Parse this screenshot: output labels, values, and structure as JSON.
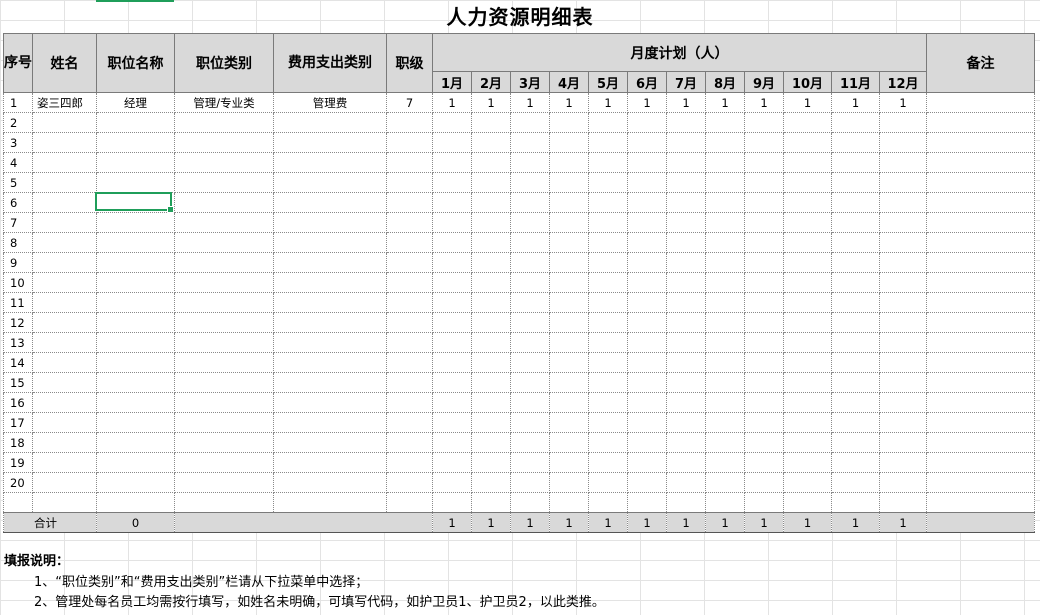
{
  "title": "人力资源明细表",
  "header": {
    "seq": "序号",
    "name": "姓名",
    "position_name": "职位名称",
    "position_type": "职位类别",
    "expense_type": "费用支出类别",
    "level": "职级",
    "monthly_plan": "月度计划（人）",
    "remark": "备注",
    "months": [
      "1月",
      "2月",
      "3月",
      "4月",
      "5月",
      "6月",
      "7月",
      "8月",
      "9月",
      "10月",
      "11月",
      "12月"
    ]
  },
  "rows": [
    {
      "seq": "1",
      "name": "姿三四郎",
      "position_name": "经理",
      "position_type": "管理/专业类",
      "expense_type": "管理费",
      "level": "7",
      "months": [
        "1",
        "1",
        "1",
        "1",
        "1",
        "1",
        "1",
        "1",
        "1",
        "1",
        "1",
        "1"
      ],
      "remark": ""
    },
    {
      "seq": "2"
    },
    {
      "seq": "3"
    },
    {
      "seq": "4"
    },
    {
      "seq": "5"
    },
    {
      "seq": "6"
    },
    {
      "seq": "7"
    },
    {
      "seq": "8"
    },
    {
      "seq": "9"
    },
    {
      "seq": "10"
    },
    {
      "seq": "11"
    },
    {
      "seq": "12"
    },
    {
      "seq": "13"
    },
    {
      "seq": "14"
    },
    {
      "seq": "15"
    },
    {
      "seq": "16"
    },
    {
      "seq": "17"
    },
    {
      "seq": "18"
    },
    {
      "seq": "19"
    },
    {
      "seq": "20"
    },
    {
      "seq": ""
    }
  ],
  "total": {
    "label": "合计",
    "position_count": "0",
    "months": [
      "1",
      "1",
      "1",
      "1",
      "1",
      "1",
      "1",
      "1",
      "1",
      "1",
      "1",
      "1"
    ]
  },
  "notes": {
    "title": "填报说明：",
    "lines": [
      "1、“职位类别”和“费用支出类别”栏请从下拉菜单中选择；",
      "2、管理处每名员工均需按行填写，如姓名未明确，可填写代码，如护卫员1、护卫员2，以此类推。"
    ]
  },
  "colors": {
    "selection": "#1f9e5a",
    "header_bg": "#d9d9d9"
  }
}
